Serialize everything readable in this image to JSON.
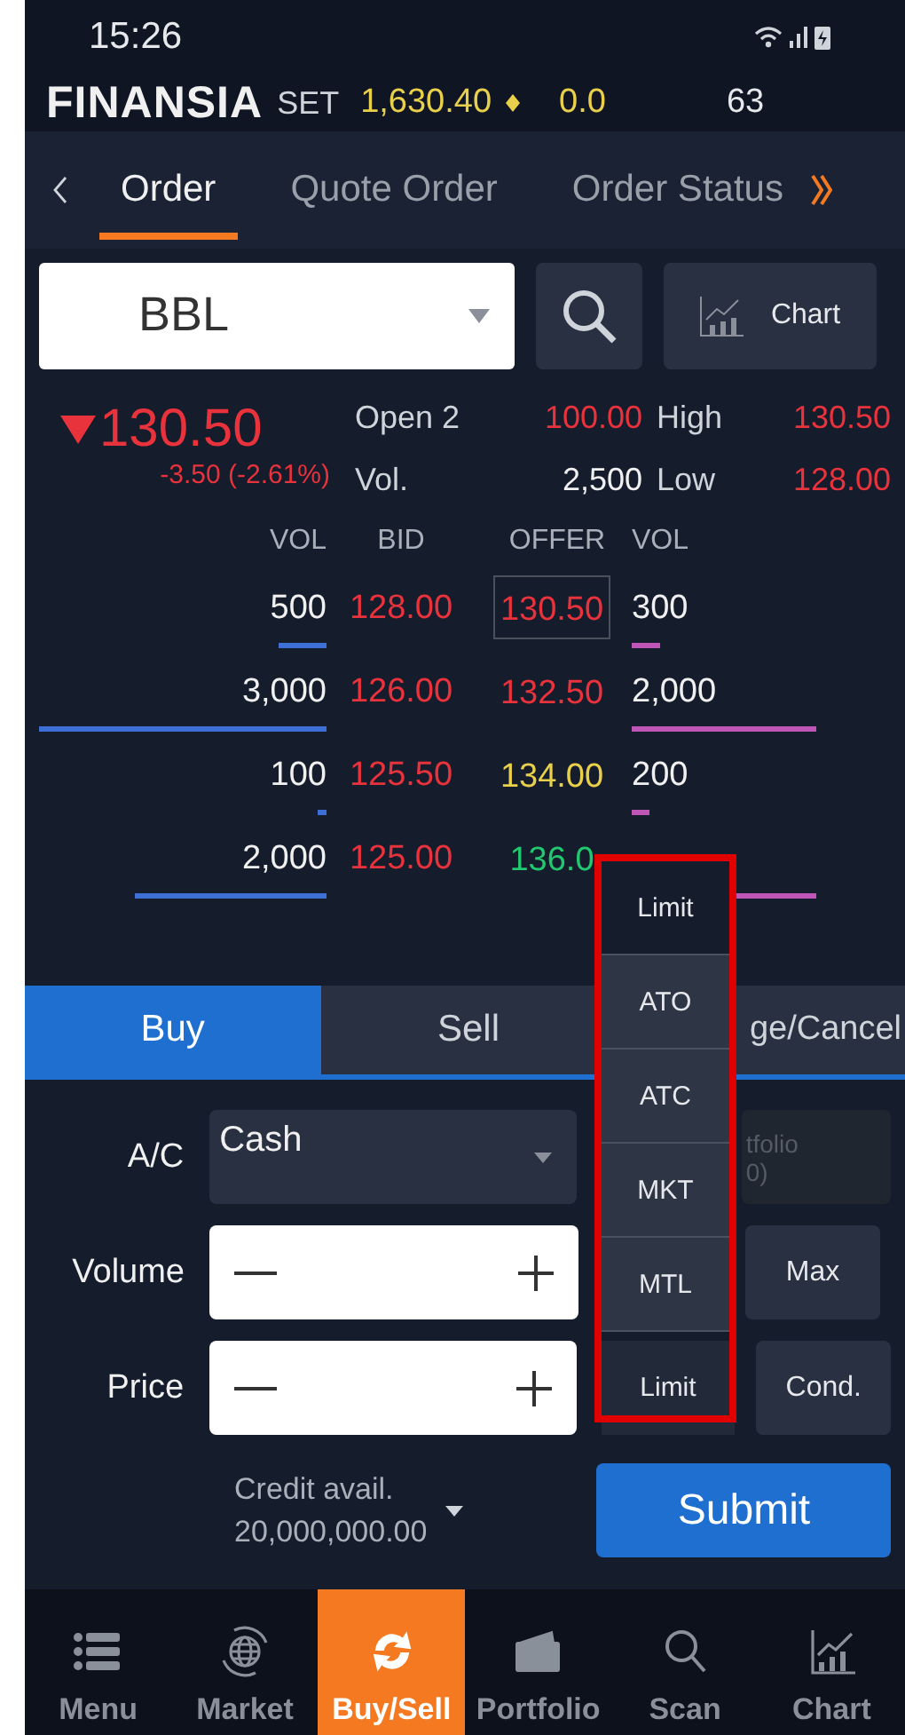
{
  "status_bar": {
    "time": "15:26"
  },
  "header": {
    "logo": "FINANSIA",
    "index_name": "SET",
    "index_value": "1,630.40",
    "index_change": "0.0",
    "count": "63"
  },
  "tabs": [
    {
      "label": "Order",
      "selected": true
    },
    {
      "label": "Quote Order",
      "selected": false
    },
    {
      "label": "Order Status",
      "selected": false
    }
  ],
  "symbol_field": {
    "value": "BBL"
  },
  "chart_button": "Chart",
  "quote": {
    "last": "130.50",
    "change": "-3.50 (-2.61%)",
    "open_label": "Open 2",
    "open": "100.00",
    "high_label": "High",
    "high": "130.50",
    "vol_label": "Vol.",
    "vol": "2,500",
    "low_label": "Low",
    "low": "128.00"
  },
  "order_book": {
    "columns": [
      "VOL",
      "BID",
      "OFFER",
      "VOL"
    ],
    "rows": [
      {
        "bid_vol": "500",
        "bid": {
          "price": "128.00",
          "color": "#e8323c"
        },
        "offer": {
          "price": "130.50",
          "color": "#e8323c"
        },
        "offer_vol": "300",
        "selected": true
      },
      {
        "bid_vol": "3,000",
        "bid": {
          "price": "126.00",
          "color": "#e8323c"
        },
        "offer": {
          "price": "132.50",
          "color": "#e8323c"
        },
        "offer_vol": "2,000",
        "selected": false
      },
      {
        "bid_vol": "100",
        "bid": {
          "price": "125.50",
          "color": "#e8323c"
        },
        "offer": {
          "price": "134.00",
          "color": "#e8d04a"
        },
        "offer_vol": "200",
        "selected": false
      },
      {
        "bid_vol": "2,000",
        "bid": {
          "price": "125.00",
          "color": "#e8323c"
        },
        "offer": {
          "price": "136.0",
          "color": "#22c870"
        },
        "selected": false
      }
    ]
  },
  "side_tabs": [
    {
      "label": "Buy",
      "selected": true
    },
    {
      "label": "Sell",
      "selected": false
    },
    {
      "label": "ge/Cancel",
      "selected": false
    }
  ],
  "form": {
    "account_label": "A/C",
    "account": "Cash",
    "portfolio_button": [
      "tfolio",
      "0)"
    ],
    "volume_label": "Volume",
    "price_label": "Price",
    "max_button": "Max",
    "price_type": "Limit",
    "cond_button": "Cond.",
    "credit_label": "Credit avail.",
    "credit_value": "20,000,000.00",
    "submit": "Submit"
  },
  "price_type_menu": {
    "options": [
      {
        "label": "Limit",
        "selected": true
      },
      {
        "label": "ATO",
        "selected": false
      },
      {
        "label": "ATC",
        "selected": false
      },
      {
        "label": "MKT",
        "selected": false
      },
      {
        "label": "MTL",
        "selected": false
      }
    ]
  },
  "bottom_nav": [
    {
      "label": "Menu",
      "kind": "menu",
      "selected": false
    },
    {
      "label": "Market",
      "kind": "market",
      "selected": false
    },
    {
      "label": "Buy/Sell",
      "kind": "trade",
      "selected": true
    },
    {
      "label": "Portfolio",
      "kind": "portfolio",
      "selected": false
    },
    {
      "label": "Scan",
      "kind": "scan",
      "selected": false
    },
    {
      "label": "Chart",
      "kind": "chart",
      "selected": false
    }
  ]
}
